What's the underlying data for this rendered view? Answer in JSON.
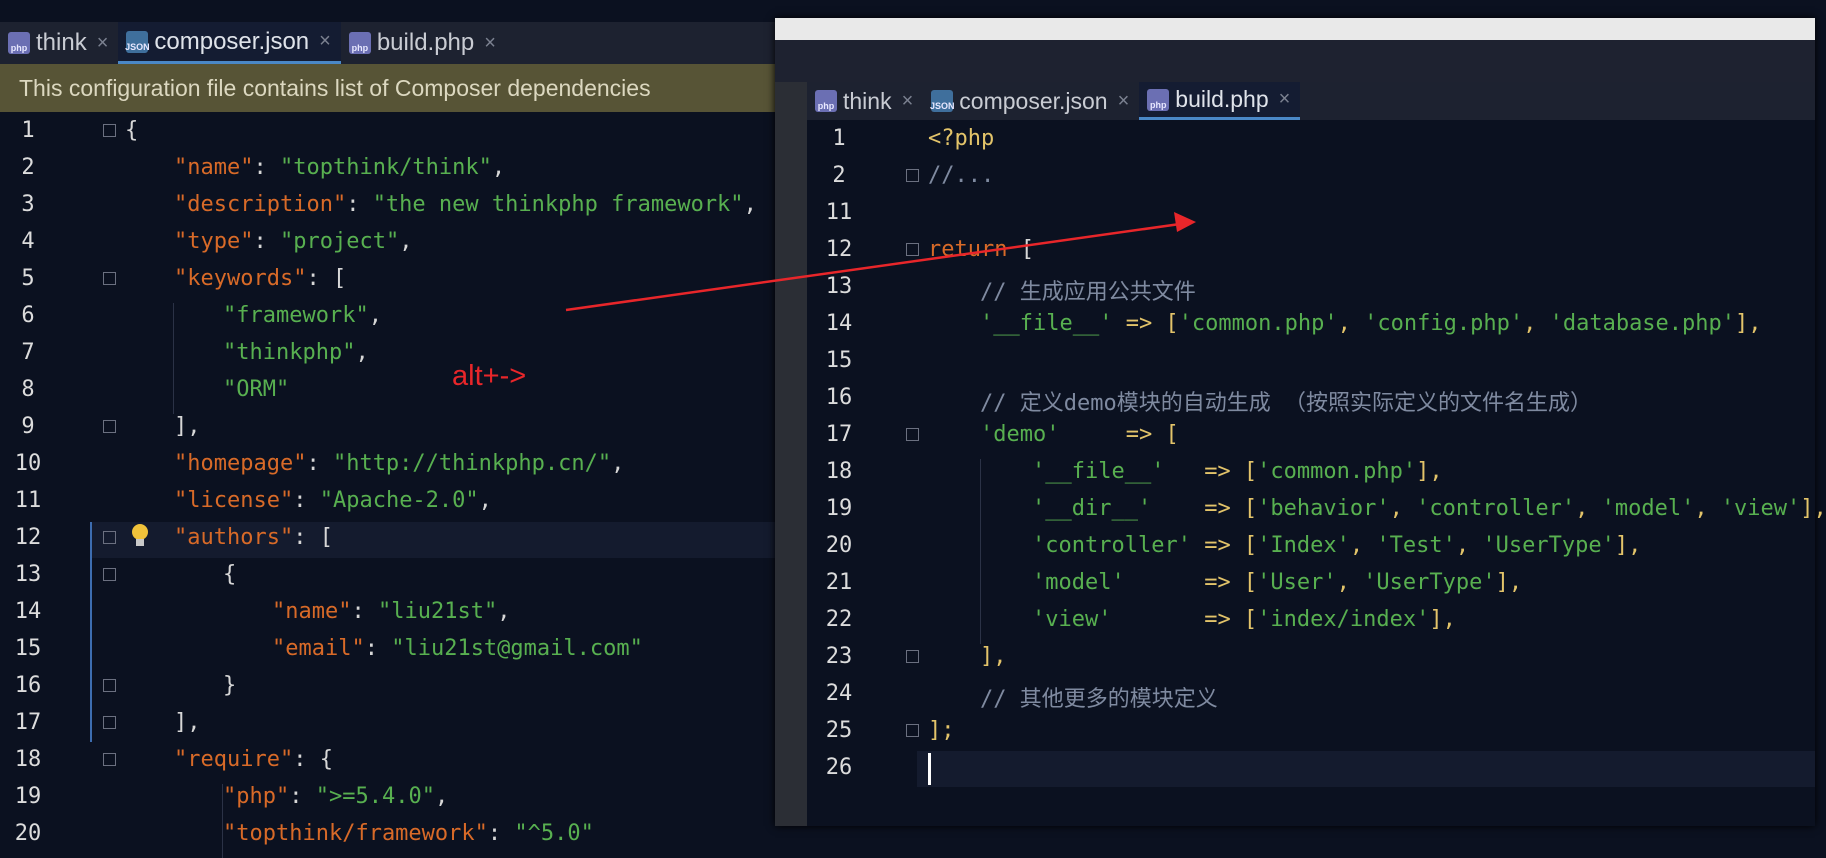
{
  "left": {
    "tabs": [
      {
        "label": "think",
        "type": "php",
        "badge": "php"
      },
      {
        "label": "composer.json",
        "type": "json",
        "badge": "JSON"
      },
      {
        "label": "build.php",
        "type": "php",
        "badge": "php"
      }
    ],
    "active_tab": 1,
    "banner": "This configuration file contains list of Composer dependencies",
    "line_numbers": [
      "1",
      "2",
      "3",
      "4",
      "5",
      "6",
      "7",
      "8",
      "9",
      "10",
      "11",
      "12",
      "13",
      "14",
      "15",
      "16",
      "17",
      "18",
      "19",
      "20"
    ],
    "code_lines": [
      "{",
      "\"name\": \"topthink/think\",",
      "\"description\": \"the new thinkphp framework\",",
      "\"type\": \"project\",",
      "\"keywords\": [",
      "\"framework\",",
      "\"thinkphp\",",
      "\"ORM\"",
      "],",
      "\"homepage\": \"http://thinkphp.cn/\",",
      "\"license\": \"Apache-2.0\",",
      "\"authors\": [",
      "{",
      "\"name\": \"liu21st\",",
      "\"email\": \"liu21st@gmail.com\"",
      "}",
      "],",
      "\"require\": {",
      "\"php\": \">=5.4.0\",",
      "\"topthink/framework\": \"^5.0\""
    ]
  },
  "right": {
    "tabs": [
      {
        "label": "think",
        "type": "php",
        "badge": "php"
      },
      {
        "label": "composer.json",
        "type": "json",
        "badge": "JSON"
      },
      {
        "label": "build.php",
        "type": "php",
        "badge": "php"
      }
    ],
    "active_tab": 2,
    "line_numbers": [
      "1",
      "2",
      "11",
      "12",
      "13",
      "14",
      "15",
      "16",
      "17",
      "18",
      "19",
      "20",
      "21",
      "22",
      "23",
      "24",
      "25",
      "26"
    ],
    "code_lines": [
      "<?php",
      "//...",
      "",
      "return [",
      "// 生成应用公共文件",
      "'__file__' => ['common.php', 'config.php', 'database.php'],",
      "",
      "// 定义demo模块的自动生成 （按照实际定义的文件名生成）",
      "'demo'     => [",
      "'__file__'   => ['common.php'],",
      "'__dir__'    => ['behavior', 'controller', 'model', 'view'],",
      "'controller' => ['Index', 'Test', 'UserType'],",
      "'model'      => ['User', 'UserType'],",
      "'view'       => ['index/index'],",
      "],",
      "// 其他更多的模块定义",
      "];",
      ""
    ]
  },
  "annotation": {
    "text": "alt+->",
    "color": "#e8262a"
  },
  "colors": {
    "background": "#0b1120",
    "banner": "#575436",
    "key": "#d86a28",
    "string": "#58b050",
    "comment": "#7f8aa0"
  }
}
